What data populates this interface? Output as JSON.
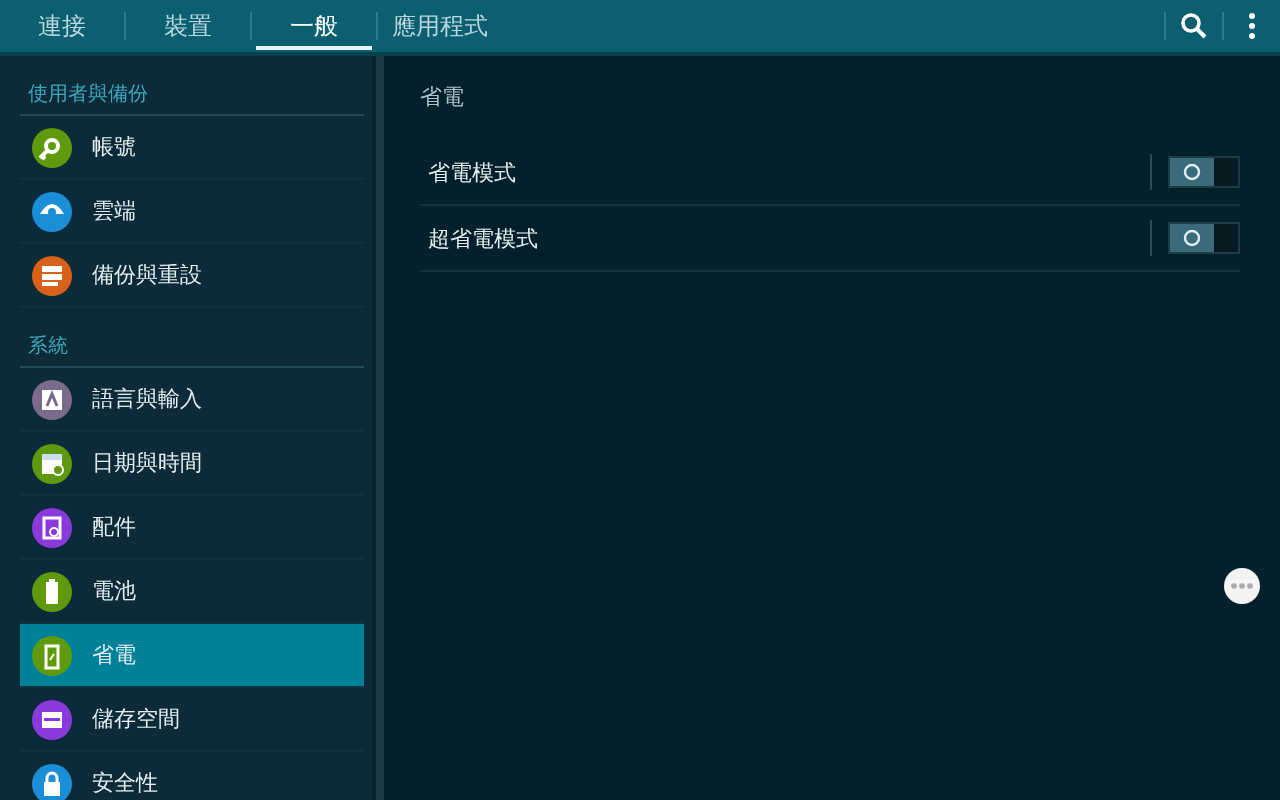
{
  "tabs": [
    {
      "label": "連接",
      "selected": false
    },
    {
      "label": "裝置",
      "selected": false
    },
    {
      "label": "一般",
      "selected": true
    },
    {
      "label": "應用程式",
      "selected": false
    }
  ],
  "sidebar": {
    "sections": [
      {
        "title": "使用者與備份",
        "items": [
          {
            "label": "帳號",
            "color": "#5e9a0c",
            "selected": false
          },
          {
            "label": "雲端",
            "color": "#1a8fd8",
            "selected": false
          },
          {
            "label": "備份與重設",
            "color": "#d8621a",
            "selected": false
          }
        ]
      },
      {
        "title": "系統",
        "items": [
          {
            "label": "語言與輸入",
            "color": "#7a6a8c",
            "selected": false
          },
          {
            "label": "日期與時間",
            "color": "#5e9a0c",
            "selected": false
          },
          {
            "label": "配件",
            "color": "#8a3adc",
            "selected": false
          },
          {
            "label": "電池",
            "color": "#5e9a0c",
            "selected": false
          },
          {
            "label": "省電",
            "color": "#5e9a0c",
            "selected": true
          },
          {
            "label": "儲存空間",
            "color": "#8a3adc",
            "selected": false
          },
          {
            "label": "安全性",
            "color": "#1a8fd8",
            "selected": false
          }
        ]
      }
    ]
  },
  "content": {
    "title": "省電",
    "settings": [
      {
        "label": "省電模式",
        "on": false
      },
      {
        "label": "超省電模式",
        "on": false
      }
    ]
  }
}
